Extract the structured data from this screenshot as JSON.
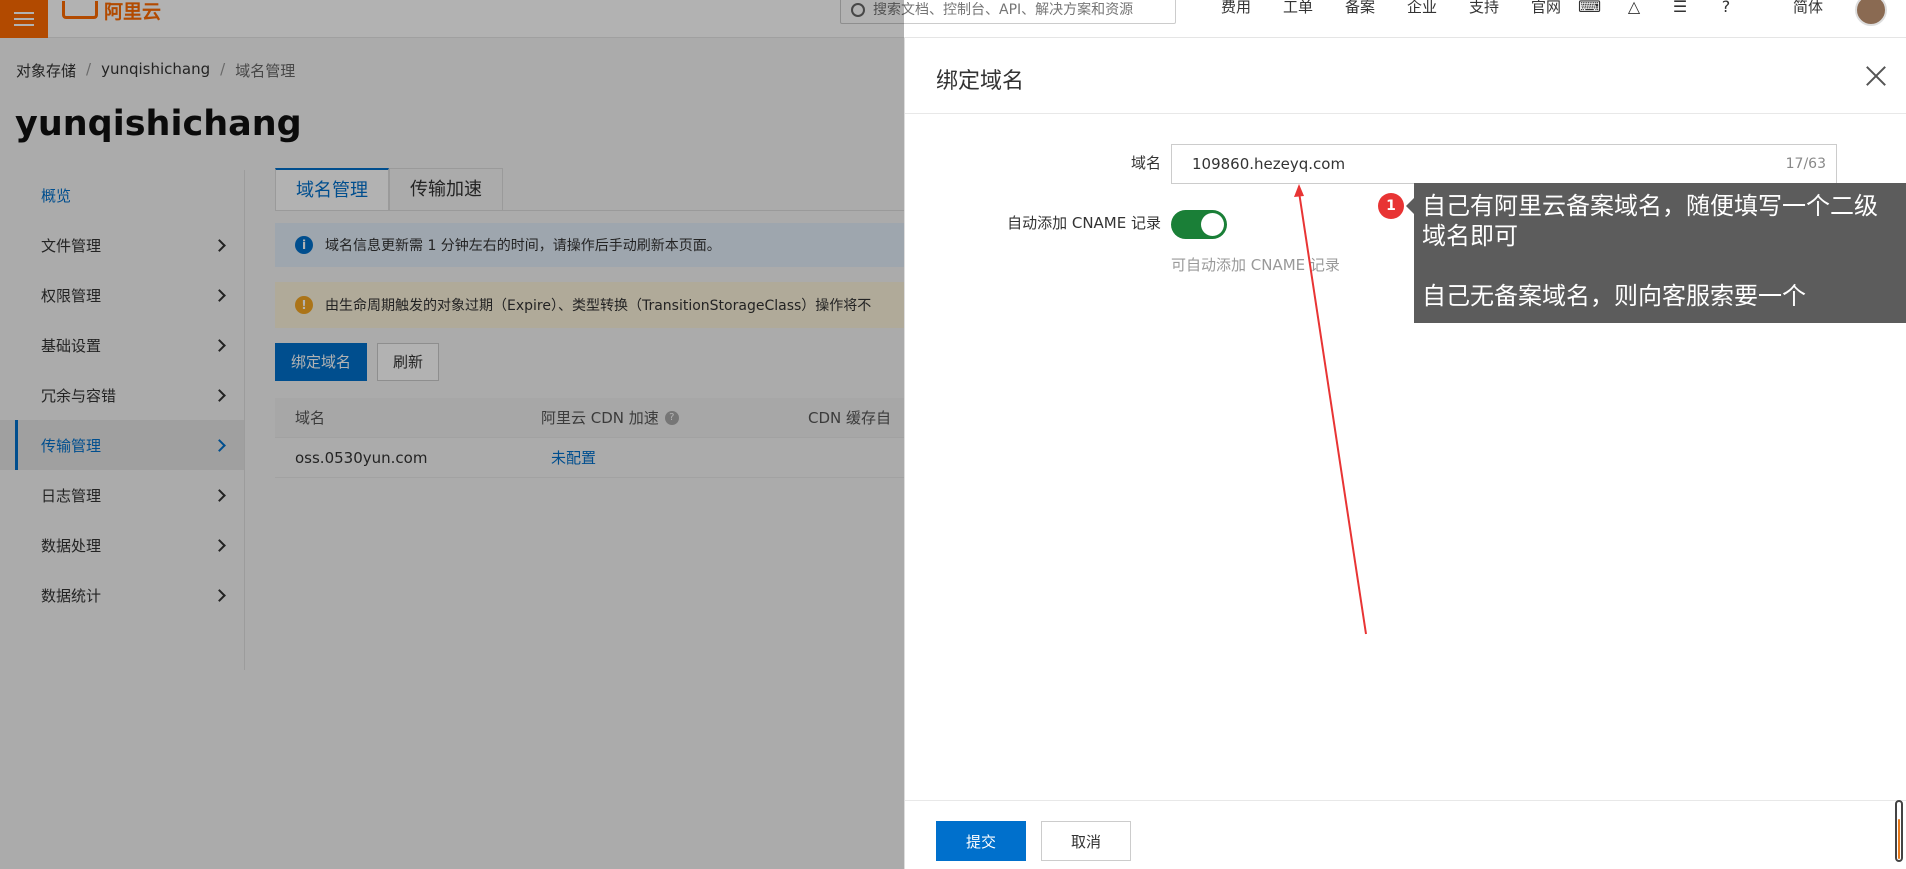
{
  "topbar": {
    "logo_text": "阿里云",
    "search_placeholder": "搜索文档、控制台、API、解决方案和资源",
    "nav": [
      "费用",
      "工单",
      "备案",
      "企业",
      "支持",
      "官网"
    ],
    "icons": [
      "terminal-icon",
      "bell-icon",
      "cart-icon",
      "help-icon"
    ],
    "lang": "简体"
  },
  "breadcrumb": [
    "对象存储",
    "yunqishichang",
    "域名管理"
  ],
  "page_title": "yunqishichang",
  "sidebar": {
    "items": [
      {
        "label": "概览"
      },
      {
        "label": "文件管理"
      },
      {
        "label": "权限管理"
      },
      {
        "label": "基础设置"
      },
      {
        "label": "冗余与容错"
      },
      {
        "label": "传输管理"
      },
      {
        "label": "日志管理"
      },
      {
        "label": "数据处理"
      },
      {
        "label": "数据统计"
      }
    ]
  },
  "tabs": [
    "域名管理",
    "传输加速"
  ],
  "notices": {
    "info": "域名信息更新需 1 分钟左右的时间，请操作后手动刷新本页面。",
    "warn": "由生命周期触发的对象过期（Expire）、类型转换（TransitionStorageClass）操作将不"
  },
  "buttons": {
    "bind": "绑定域名",
    "refresh": "刷新"
  },
  "table": {
    "headers": [
      "域名",
      "阿里云 CDN 加速",
      "CDN 缓存自"
    ],
    "rows": [
      {
        "domain": "oss.0530yun.com",
        "cdn": "未配置"
      }
    ]
  },
  "drawer": {
    "title": "绑定域名",
    "domain_label": "域名",
    "domain_value": "109860.hezeyq.com",
    "domain_count": "17/63",
    "cname_label": "自动添加 CNAME 记录",
    "cname_help": "可自动添加 CNAME 记录",
    "submit": "提交",
    "cancel": "取消"
  },
  "annotation": {
    "badge": "1",
    "line1": "自己有阿里云备案域名，随便填写一个二级域名即可",
    "line2": "自己无备案域名，则向客服索要一个"
  },
  "colors": {
    "accent": "#0070cc",
    "brand": "#ff6a00",
    "toggle_on": "#1a7f37",
    "annotation_red": "#e83434"
  }
}
